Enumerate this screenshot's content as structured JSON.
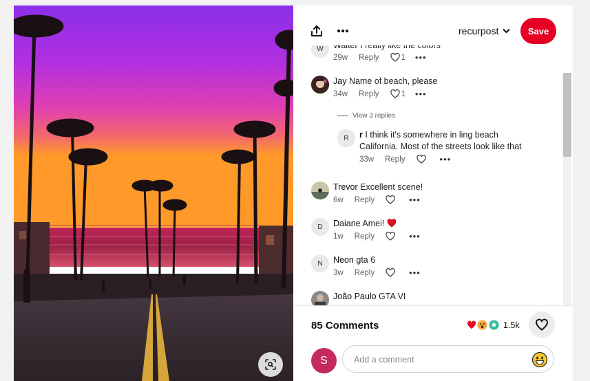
{
  "header": {
    "board_name": "recurpost",
    "save_label": "Save",
    "share_icon": "share-icon",
    "more_icon": "more-options-icon"
  },
  "comments": [
    {
      "avatar_letter": "W",
      "author": "Walter",
      "text": "I really like the colors",
      "time": "29w",
      "reply_label": "Reply",
      "likes": "1",
      "more": "•••"
    },
    {
      "avatar_letter": "",
      "author": "Jay",
      "text": "Name of beach, please",
      "time": "34w",
      "reply_label": "Reply",
      "likes": "1",
      "more": "•••"
    },
    {
      "avatar_letter": "",
      "author": "Trevor",
      "text": "Excellent scene!",
      "time": "6w",
      "reply_label": "Reply",
      "more": "•••"
    },
    {
      "avatar_letter": "D",
      "author": "Daiane",
      "text": "Amei!",
      "time": "1w",
      "reply_label": "Reply",
      "more": "•••"
    },
    {
      "avatar_letter": "N",
      "author": "Neon",
      "text": "gta 6",
      "time": "3w",
      "reply_label": "Reply",
      "more": "•••"
    },
    {
      "avatar_letter": "",
      "author": "João Paulo",
      "text": "GTA VI"
    }
  ],
  "view_replies_label": "View 3 replies",
  "reply": {
    "avatar_letter": "R",
    "author": "r",
    "text": "I think it's somewhere in ling beach California. Most of the streets look like that",
    "time": "33w",
    "reply_label": "Reply",
    "more": "•••"
  },
  "footer": {
    "comment_count": "85 Comments",
    "reaction_count": "1.5k",
    "user_avatar_letter": "S",
    "input_placeholder": "Add a comment"
  },
  "colors": {
    "save_red": "#e60023",
    "user_avatar": "#c42a5e"
  }
}
